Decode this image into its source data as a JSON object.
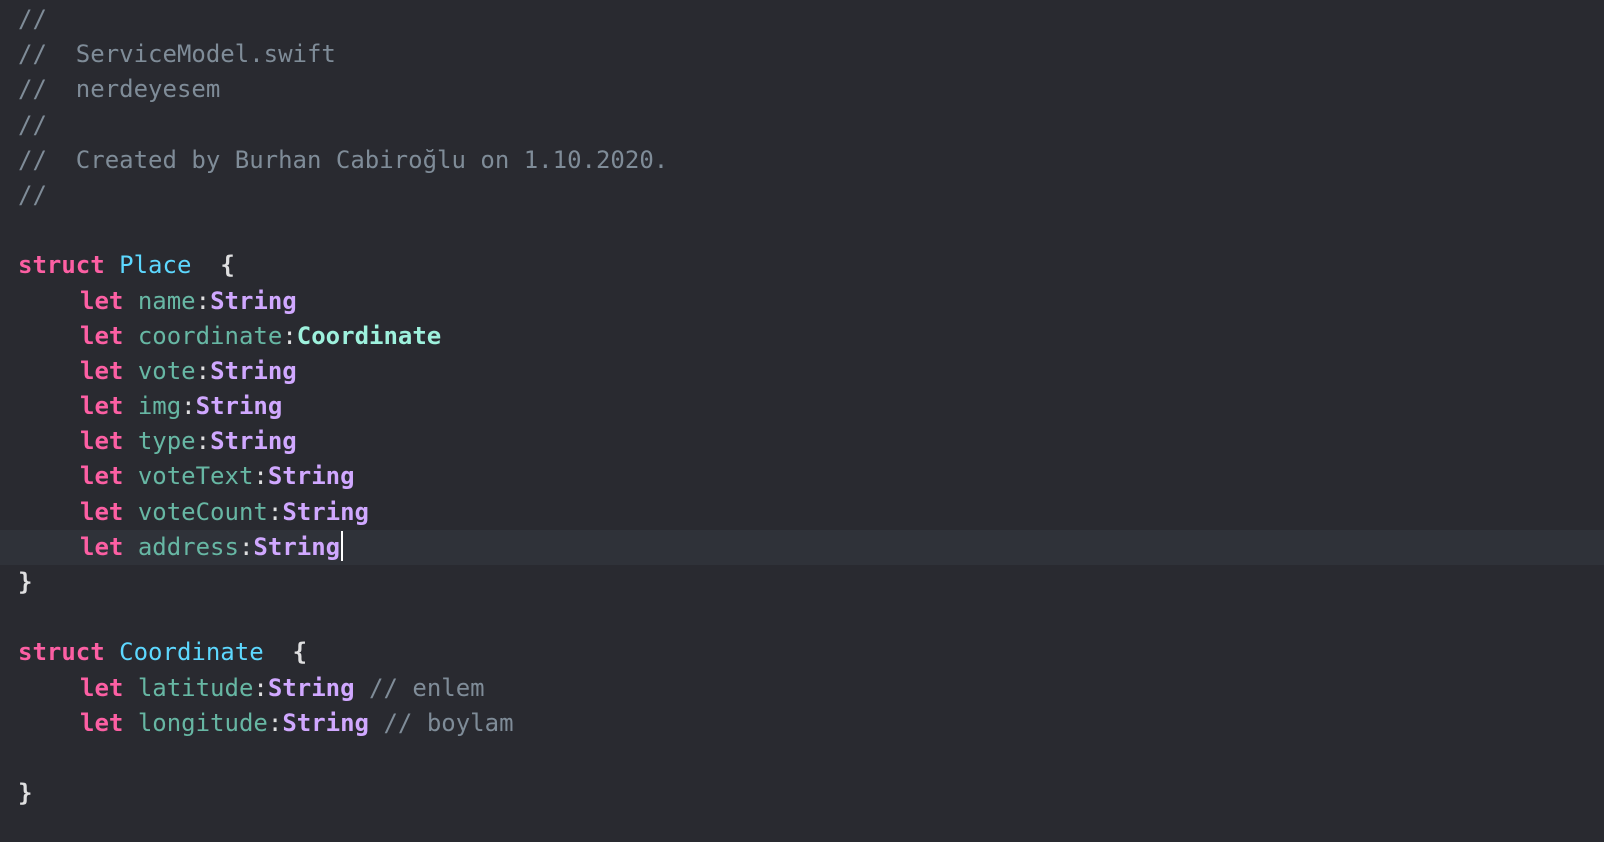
{
  "header_comments": [
    "//",
    "//  ServiceModel.swift",
    "//  nerdeyesem",
    "//",
    "//  Created by Burhan Cabiroğlu on 1.10.2020.",
    "//"
  ],
  "struct_place": {
    "keyword": "struct",
    "name": "Place",
    "open_brace": "{",
    "close_brace": "}",
    "fields": [
      {
        "kw": "let",
        "name": "name",
        "colon": ":",
        "type": "String"
      },
      {
        "kw": "let",
        "name": "coordinate",
        "colon": ":",
        "type": "Coordinate"
      },
      {
        "kw": "let",
        "name": "vote",
        "colon": ":",
        "type": "String"
      },
      {
        "kw": "let",
        "name": "img",
        "colon": ":",
        "type": "String"
      },
      {
        "kw": "let",
        "name": "type",
        "colon": ":",
        "type": "String"
      },
      {
        "kw": "let",
        "name": "voteText",
        "colon": ":",
        "type": "String"
      },
      {
        "kw": "let",
        "name": "voteCount",
        "colon": ":",
        "type": "String"
      },
      {
        "kw": "let",
        "name": "address",
        "colon": ":",
        "type": "String"
      }
    ]
  },
  "struct_coordinate": {
    "keyword": "struct",
    "name": "Coordinate",
    "open_brace": "{",
    "close_brace": "}",
    "fields": [
      {
        "kw": "let",
        "name": "latitude",
        "colon": ":",
        "type": "String",
        "comment": "// enlem"
      },
      {
        "kw": "let",
        "name": "longitude",
        "colon": ":",
        "type": "String",
        "comment": "// boylam"
      }
    ]
  },
  "colors": {
    "background": "#292a30",
    "current_line": "#2f3239",
    "comment": "#7f8c98",
    "keyword": "#fc5fa3",
    "type_declaration": "#5dd8ff",
    "property": "#67b7a4",
    "system_type": "#d0a8ff",
    "project_type": "#9ef1dd"
  }
}
